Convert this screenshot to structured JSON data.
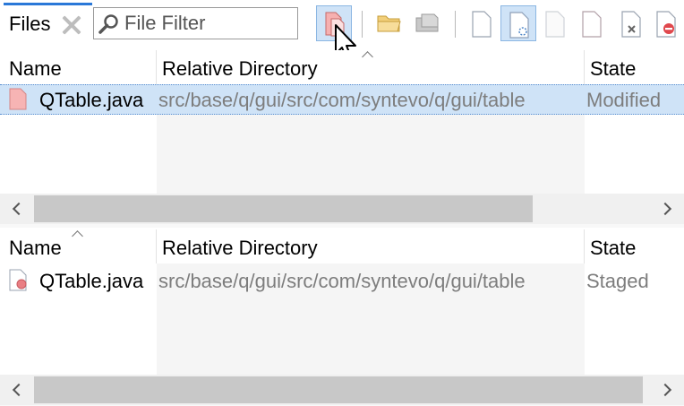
{
  "tab": {
    "title": "Files"
  },
  "filter": {
    "placeholder": "File Filter",
    "value": ""
  },
  "toolbar": {
    "buttons": [
      {
        "icon": "show-modified-icon",
        "active": true
      },
      {
        "icon": "open-folder-icon"
      },
      {
        "icon": "open-in-explorer-icon"
      },
      {
        "icon": "show-unchanged-icon"
      },
      {
        "icon": "show-ignored-icon",
        "active": true
      },
      {
        "icon": "show-unversioned-icon"
      },
      {
        "icon": "show-modified-files-icon"
      },
      {
        "icon": "show-missing-icon"
      },
      {
        "icon": "show-removed-icon"
      }
    ]
  },
  "top_table": {
    "columns": [
      "Name",
      "Relative Directory",
      "State"
    ],
    "rows": [
      {
        "name": "QTable.java",
        "dir": "src/base/q/gui/src/com/syntevo/q/gui/table",
        "state": "Modified"
      }
    ]
  },
  "bottom_table": {
    "columns": [
      "Name",
      "Relative Directory",
      "State"
    ],
    "rows": [
      {
        "name": "QTable.java",
        "dir": "src/base/q/gui/src/com/syntevo/q/gui/table",
        "state": "Staged"
      }
    ]
  },
  "colors": {
    "accent": "#2a78d8",
    "selection": "#cfe3f7",
    "file_modified": "#f4a7a7",
    "muted_text": "#7d7d7d"
  }
}
